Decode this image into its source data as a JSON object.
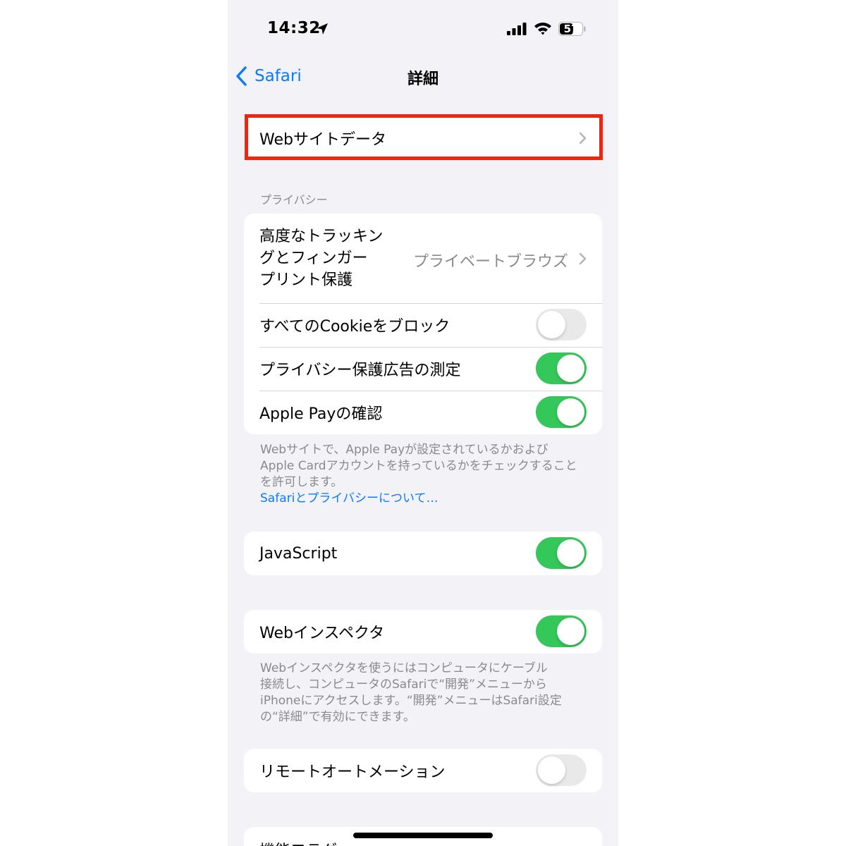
{
  "status_bar": {
    "time": "14:32",
    "battery": "57",
    "icons": [
      "location-arrow-icon",
      "cellular-signal-icon",
      "wifi-icon",
      "battery-icon"
    ]
  },
  "nav": {
    "back_label": "Safari",
    "title": "詳細"
  },
  "website_data": {
    "label": "Webサイトデータ"
  },
  "privacy": {
    "header": "プライバシー",
    "tracking_label_lines": [
      "高度なトラッキン",
      "グとフィンガー",
      "プリント保護"
    ],
    "tracking_value": "プライベートブラウズ",
    "block_cookies": {
      "label": "すべてのCookieをブロック",
      "on": false
    },
    "ad_measurement": {
      "label": "プライバシー保護広告の測定",
      "on": true
    },
    "apple_pay": {
      "label": "Apple Payの確認",
      "on": true
    },
    "footer_lines": [
      "Webサイトで、Apple Payが設定されているかおよび",
      "Apple Cardアカウントを持っているかをチェックすること",
      "を許可します。"
    ],
    "footer_link": "Safariとプライバシーについて…"
  },
  "javascript": {
    "label": "JavaScript",
    "on": true
  },
  "web_inspector": {
    "label": "Webインスペクタ",
    "on": true,
    "footer_lines": [
      "Webインスペクタを使うにはコンピュータにケーブル",
      "接続し、コンピュータのSafariで“開発”メニューから",
      "iPhoneにアクセスします。“開発”メニューはSafari設定",
      "の“詳細”で有効にできます。"
    ]
  },
  "remote_automation": {
    "label": "リモートオートメーション",
    "on": false
  },
  "feature_flags": {
    "label": "機能フラグ"
  },
  "colors": {
    "background": "#f2f2f7",
    "accent": "#0a7aff",
    "toggle_on": "#34c759",
    "toggle_off": "#e9e9ea",
    "highlight": "#f5230b"
  }
}
